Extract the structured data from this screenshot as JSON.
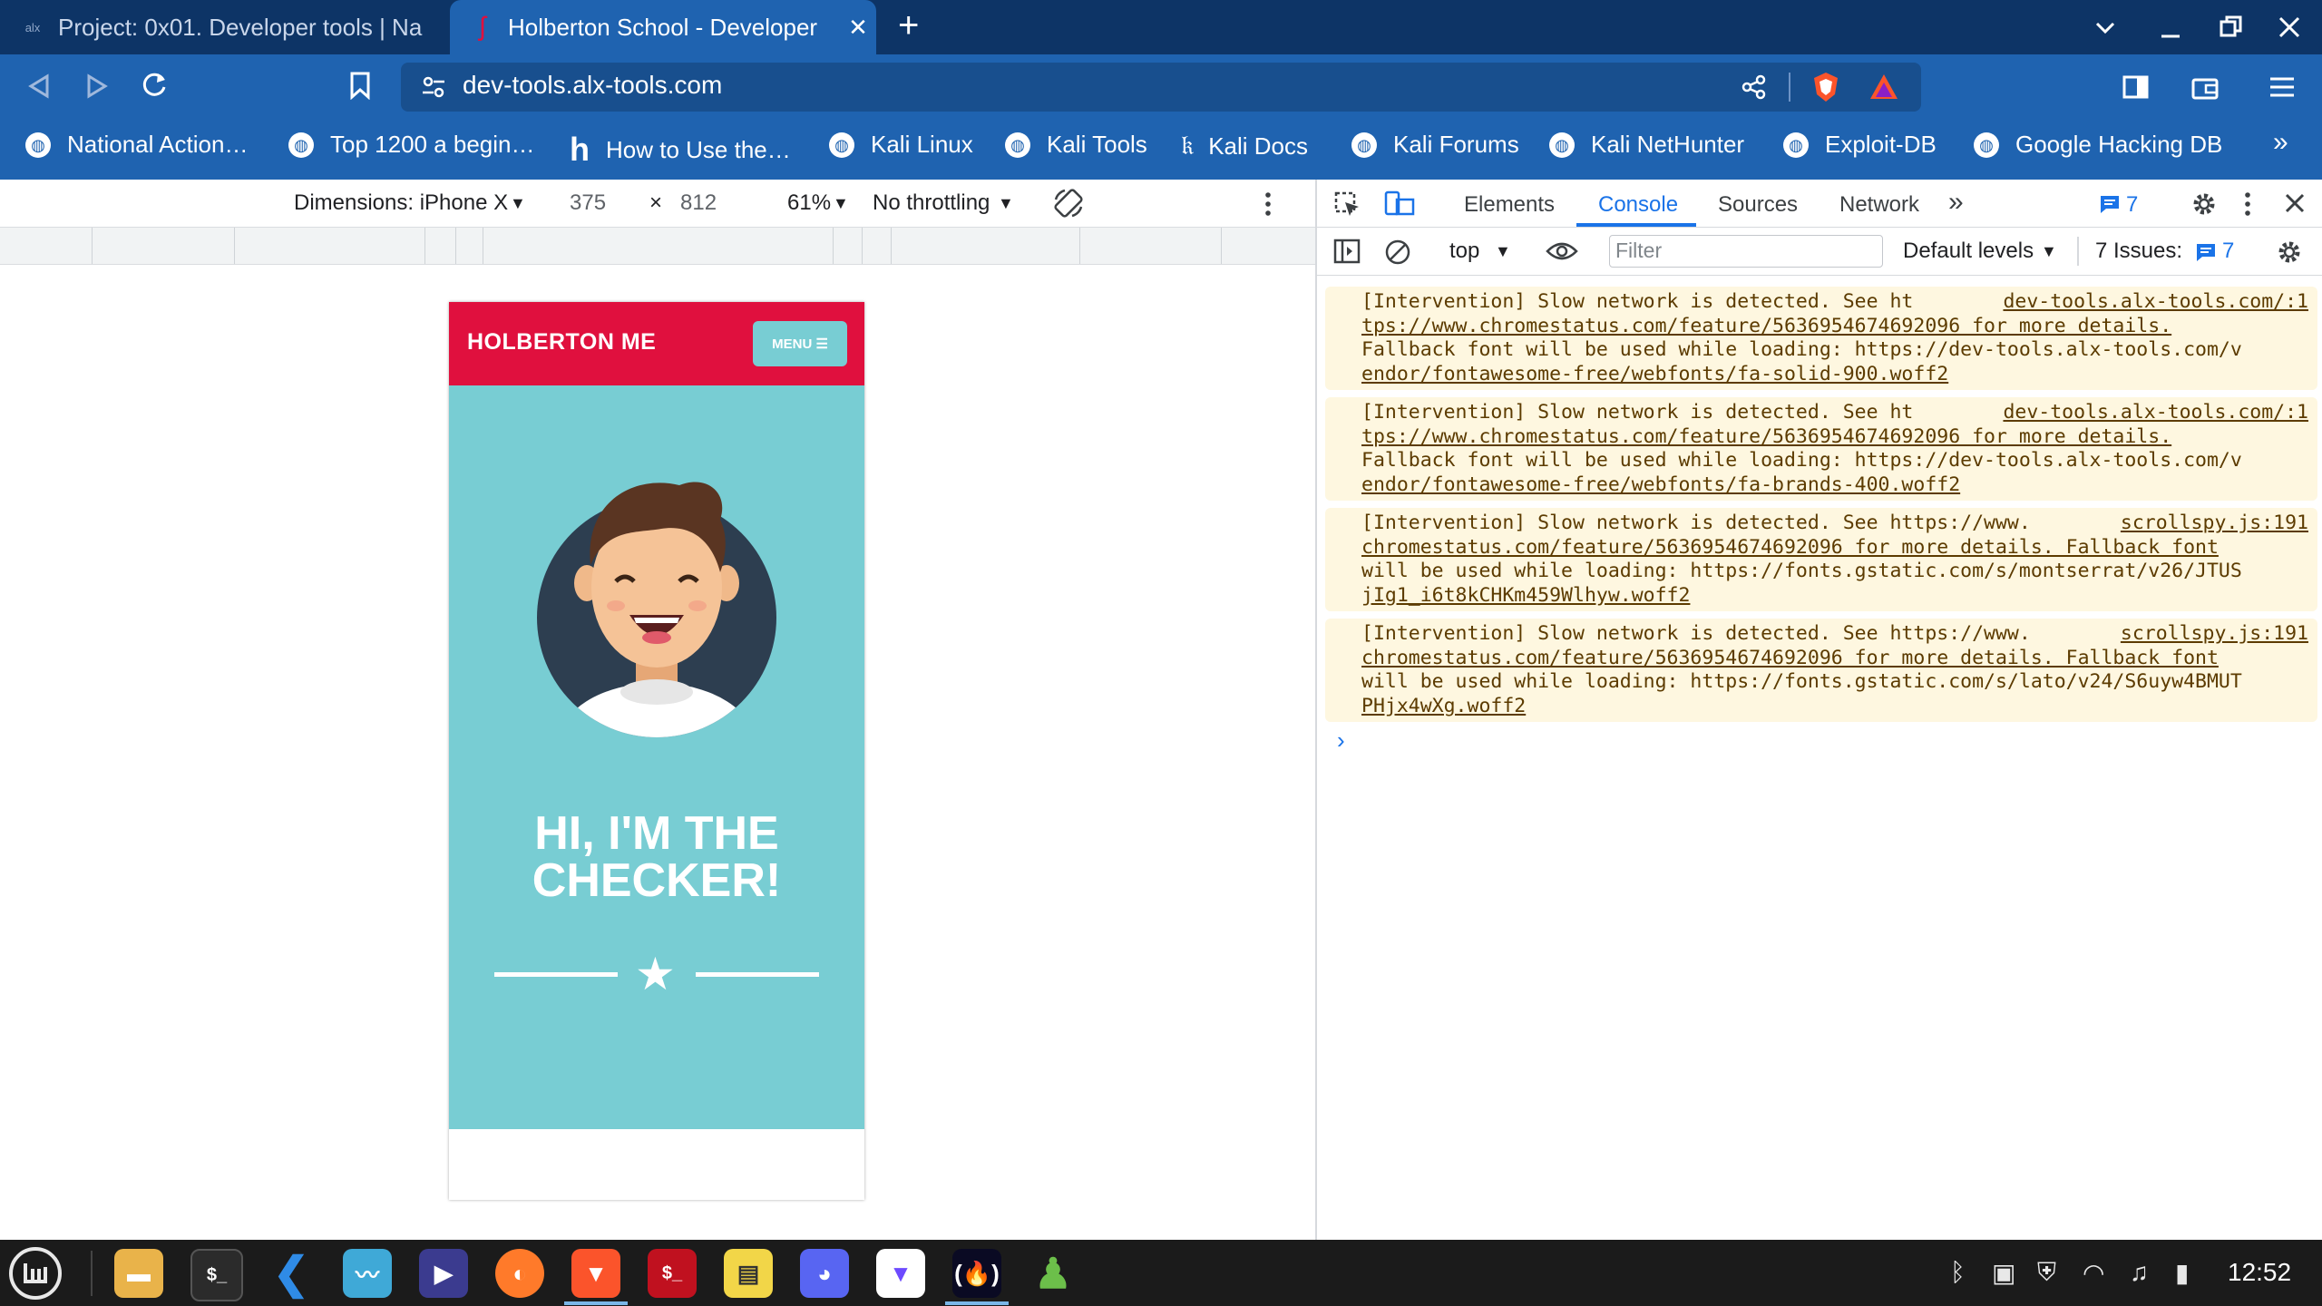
{
  "browser": {
    "tabs": [
      {
        "title": "Project: 0x01. Developer tools | Na",
        "favicon": "alx-icon",
        "active": false
      },
      {
        "title": "Holberton School - Developer",
        "favicon": "holberton-icon",
        "active": true
      }
    ],
    "close_symbol": "✕",
    "new_tab_symbol": "+",
    "url": "dev-tools.alx-tools.com",
    "bookmarks": [
      "National Action…",
      "Top 1200 a begin…",
      "How to Use the…",
      "Kali Linux",
      "Kali Tools",
      "Kali Docs",
      "Kali Forums",
      "Kali NetHunter",
      "Exploit-DB",
      "Google Hacking DB"
    ],
    "bookmarks_overflow": "»"
  },
  "device_toolbar": {
    "dimensions_label": "Dimensions: iPhone X",
    "width": "375",
    "times": "×",
    "height": "812",
    "zoom": "61%",
    "throttling": "No throttling"
  },
  "page": {
    "brand": "HOLBERTON ME",
    "menu_label": "MENU ☰",
    "hero_title_line1": "HI, I'M THE",
    "hero_title_line2": "CHECKER!",
    "colors": {
      "header": "#e0103e",
      "hero": "#78cdd3",
      "text": "#ffffff"
    }
  },
  "devtools": {
    "tabs": [
      "Elements",
      "Console",
      "Sources",
      "Network"
    ],
    "active_tab": "Console",
    "more_tabs": "»",
    "message_count": "7",
    "context": "top",
    "filter_placeholder": "Filter",
    "levels": "Default levels",
    "issues_label": "7 Issues:",
    "issues_count": "7",
    "messages": [
      {
        "source": "dev-tools.alx-tools.com/:1",
        "lines": [
          "[Intervention] Slow network is detected. See ht",
          "tps://www.chromestatus.com/feature/5636954674692096 for more details.",
          "Fallback font will be used while loading: https://dev-tools.alx-tools.com/v",
          "endor/fontawesome-free/webfonts/fa-solid-900.woff2"
        ]
      },
      {
        "source": "dev-tools.alx-tools.com/:1",
        "lines": [
          "[Intervention] Slow network is detected. See ht",
          "tps://www.chromestatus.com/feature/5636954674692096 for more details.",
          "Fallback font will be used while loading: https://dev-tools.alx-tools.com/v",
          "endor/fontawesome-free/webfonts/fa-brands-400.woff2"
        ]
      },
      {
        "source": "scrollspy.js:191",
        "lines": [
          "[Intervention] Slow network is detected. See https://www.",
          "chromestatus.com/feature/5636954674692096 for more details. Fallback font",
          "will be used while loading: https://fonts.gstatic.com/s/montserrat/v26/JTUS",
          "jIg1_i6t8kCHKm459Wlhyw.woff2"
        ]
      },
      {
        "source": "scrollspy.js:191",
        "lines": [
          "[Intervention] Slow network is detected. See https://www.",
          "chromestatus.com/feature/5636954674692096 for more details. Fallback font",
          "will be used while loading: https://fonts.gstatic.com/s/lato/v24/S6uyw4BMUT",
          "PHjx4wXg.woff2"
        ]
      }
    ],
    "prompt_symbol": "›"
  },
  "taskbar": {
    "apps": [
      "files-icon",
      "terminal-icon",
      "vscode-icon",
      "monitor-icon",
      "media-player-icon",
      "firefox-icon",
      "brave-icon",
      "terminal-red-icon",
      "notes-icon",
      "discord-icon",
      "proton-vpn-icon",
      "freecodecamp-icon",
      "chess-icon"
    ],
    "clock": "12:52"
  }
}
